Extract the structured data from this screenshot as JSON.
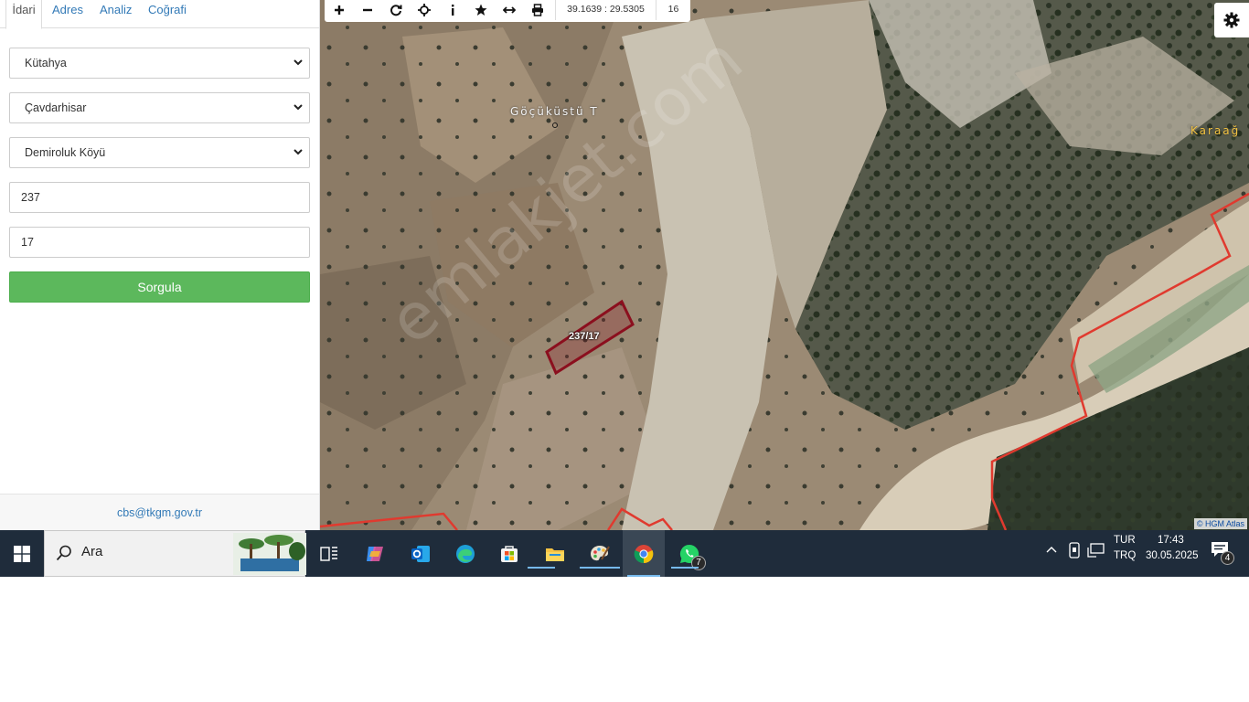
{
  "tabs": [
    {
      "label": "İdari",
      "active": true
    },
    {
      "label": "Adres",
      "active": false
    },
    {
      "label": "Analiz",
      "active": false
    },
    {
      "label": "Coğrafi",
      "active": false
    }
  ],
  "form": {
    "il": "Kütahya",
    "ilce": "Çavdarhisar",
    "mahalle": "Demiroluk Köyü",
    "ada": "237",
    "parsel": "17",
    "submit_label": "Sorgula"
  },
  "footer_email": "cbs@tkgm.gov.tr",
  "map": {
    "coordinates": "39.1639 : 29.5305",
    "zoom_level": "16",
    "place_label_1": "Göçüküstü T",
    "place_label_2": "Karaağ",
    "parcel_label": "237/17",
    "watermark": "emlakjet.com",
    "attribution": "© HGM Atlas",
    "toolbar_icons": [
      "plus-icon",
      "minus-icon",
      "refresh-icon",
      "crosshair-icon",
      "info-icon",
      "star-icon",
      "measure-icon",
      "print-icon"
    ]
  },
  "taskbar": {
    "search_placeholder": "Ara",
    "whatsapp_badge": "7",
    "language": "TUR",
    "keyboard": "TRQ",
    "time": "17:43",
    "date": "30.05.2025",
    "notification_count": "4"
  },
  "colors": {
    "link": "#337ab7",
    "button_green": "#5cb85c",
    "parcel_border": "#8b0f1e",
    "boundary_red": "#e03a2f",
    "taskbar_bg": "#1f2c3b"
  }
}
